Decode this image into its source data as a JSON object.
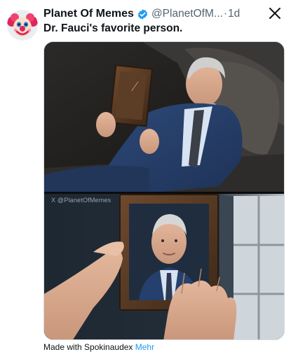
{
  "tweet": {
    "author_name": "Planet Of Memes",
    "author_handle": "@PlanetOfM...",
    "separator": "·",
    "time": "1d",
    "text": "Dr. Fauci's favorite person.",
    "avatar_icon": "clown-face-icon",
    "verified_color": "#1d9bf0",
    "media_watermark": "X @PlanetOfMemes",
    "footer_left": "Made with Spokinaudex",
    "footer_link": "Mehr"
  },
  "toolbar": {
    "close_icon": "close-icon"
  }
}
